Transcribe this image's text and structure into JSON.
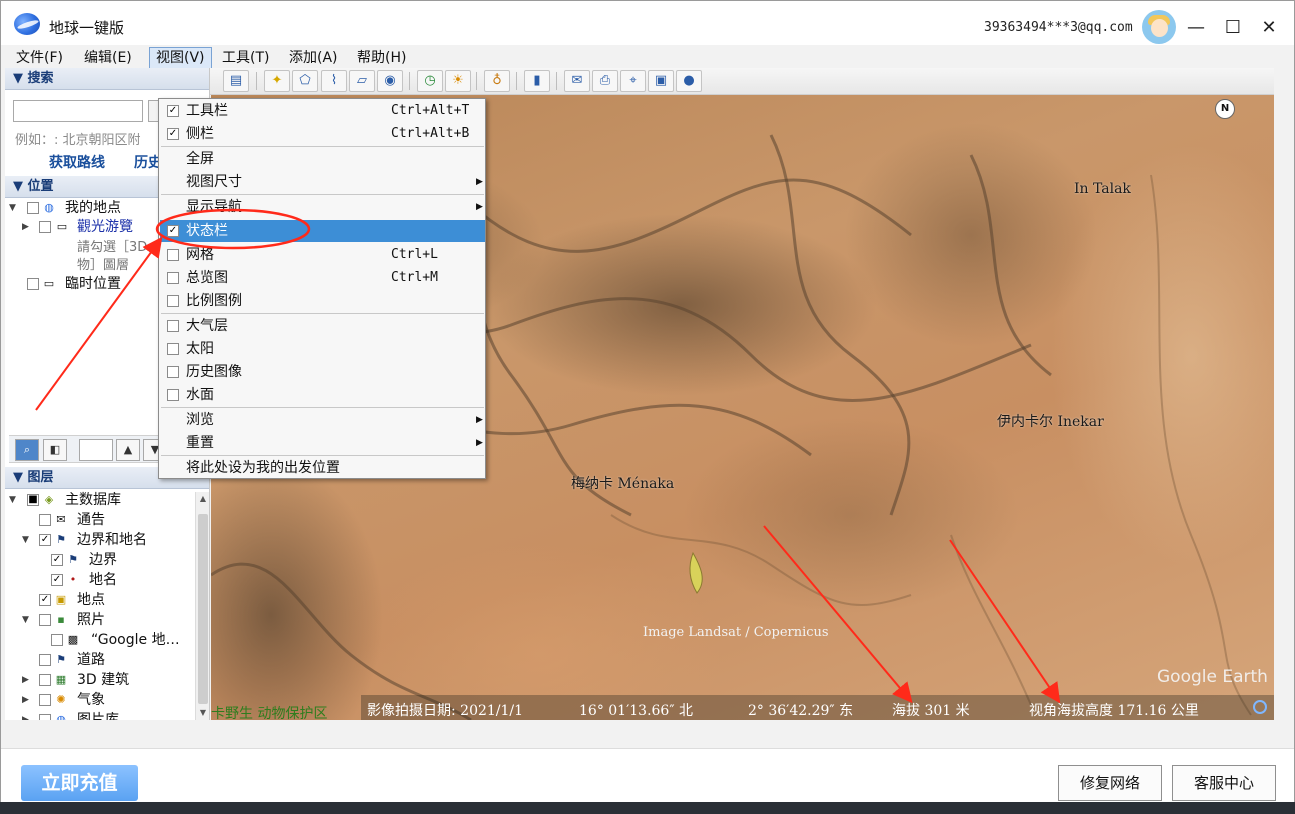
{
  "app": {
    "title": "地球一键版",
    "account": "39363494***3@qq.com"
  },
  "window_controls": {
    "minimize": "—",
    "maximize": "☐",
    "close": "✕"
  },
  "menubar": [
    {
      "label": "文件(F)"
    },
    {
      "label": "编辑(E)"
    },
    {
      "label": "视图(V)"
    },
    {
      "label": "工具(T)"
    },
    {
      "label": "添加(A)"
    },
    {
      "label": "帮助(H)"
    }
  ],
  "toolbar_icons": [
    "sidebar-toggle-icon",
    "placemark-icon",
    "polygon-icon",
    "path-icon",
    "overlay-icon",
    "tour-icon",
    "history-clock-icon",
    "sunlight-icon",
    "planet-icon",
    "ruler-icon",
    "email-icon",
    "print-icon",
    "view-in-maps-icon",
    "save-image-icon",
    "earth-globe-icon"
  ],
  "search": {
    "title": "搜索",
    "placeholder": "",
    "hint": "例如：: 北京朝阳区附",
    "get_route": "获取路线",
    "history": "历史"
  },
  "places": {
    "title": "位置",
    "items": [
      {
        "label": "我的地点"
      },
      {
        "label": "觀光游覽"
      },
      {
        "label": "臨时位置"
      }
    ],
    "sub_lines": [
      "請勾選［3D",
      "物］圖層"
    ]
  },
  "layers": {
    "title": "图层",
    "items": [
      {
        "label": "主数据库"
      },
      {
        "label": "通告"
      },
      {
        "label": "边界和地名"
      },
      {
        "label": "边界"
      },
      {
        "label": "地名"
      },
      {
        "label": "地点"
      },
      {
        "label": "照片"
      },
      {
        "label": "“Google 地…"
      },
      {
        "label": "道路"
      },
      {
        "label": "3D 建筑"
      },
      {
        "label": "气象"
      },
      {
        "label": "图片库"
      }
    ]
  },
  "view_menu": {
    "items": [
      {
        "label": "工具栏",
        "shortcut": "Ctrl+Alt+T",
        "checked": true
      },
      {
        "label": "侧栏",
        "shortcut": "Ctrl+Alt+B",
        "checked": true
      },
      {
        "label": "全屏"
      },
      {
        "label": "视图尺寸",
        "submenu": true
      },
      {
        "label": "显示导航",
        "submenu": true
      },
      {
        "label": "状态栏",
        "checked": true,
        "highlighted": true
      },
      {
        "label": "网格",
        "shortcut": "Ctrl+L",
        "checked": false
      },
      {
        "label": "总览图",
        "shortcut": "Ctrl+M",
        "checked": false
      },
      {
        "label": "比例图例",
        "checked": false
      },
      {
        "label": "大气层",
        "checked": false
      },
      {
        "label": "太阳",
        "checked": false
      },
      {
        "label": "历史图像",
        "checked": false
      },
      {
        "label": "水面",
        "checked": false
      },
      {
        "label": "浏览",
        "submenu": true
      },
      {
        "label": "重置",
        "submenu": true
      },
      {
        "label": "将此处设为我的出发位置"
      }
    ]
  },
  "map": {
    "labels": {
      "in_talak": "In Talak",
      "inekar": "伊内卡尔 Inekar",
      "menaka": "梅纳卡 Ménaka"
    },
    "copyright": "Image Landsat / Copernicus",
    "brand": "Google Earth",
    "north": "N",
    "reserve": "卡野生 动物保护区"
  },
  "status": {
    "date": "影像拍摄日期: 2021/1/1",
    "lat": "16° 01′13.66″ 北",
    "lon": "2° 36′42.29″ 东",
    "elev": "海拔   301 米",
    "eye": "视角海拔高度 171.16 公里"
  },
  "bottom": {
    "recharge": "立即充值",
    "repair": "修复网络",
    "support": "客服中心"
  },
  "colors": {
    "highlight": "#3d8ed6",
    "annotation": "#ff2a1a",
    "link": "#1a4f9c"
  }
}
